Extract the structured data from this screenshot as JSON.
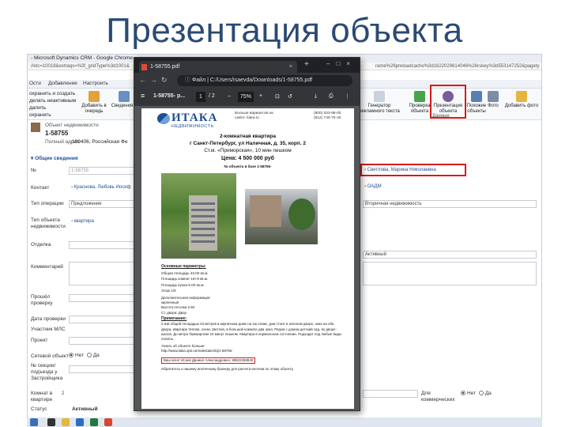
{
  "slide": {
    "title": "Презентация объекта"
  },
  "crm": {
    "window_title": "- Microsoft Dynamics CRM - Google Chrome",
    "url_left": "//etc=10018&extraqs=%3f_gridType%3d1001&",
    "url_right": "rame%26preloadcache%3d1622029614046%26rskey%3d553147252&pagety",
    "tabs": [
      "Ости",
      "Добавление",
      "Настроить"
    ],
    "left_actions": [
      "охранить и создать",
      "делать неактивным",
      "далить",
      "охранить"
    ],
    "ribbon_buttons": [
      "Добавить в очередь",
      "Сведения о",
      "Генератор рекламного текста",
      "Проверка объекта",
      "Презентация объекта",
      "Похожие объекты",
      "Фото",
      "Добавить фото"
    ],
    "ribbon_sub": "Данные",
    "entity_type": "Объект недвижимости",
    "record_id": "1-58755",
    "address_label": "Полный адрес",
    "address_value": "199406, Российская Фе",
    "section_general": "Общие сведения",
    "fields": {
      "number": {
        "label": "№",
        "value": "1-58755"
      },
      "contact": {
        "label": "Контакт",
        "value": "Краснова, Любовь Иосиф"
      },
      "op_type": {
        "label": "Тип операции",
        "value": "Предложение"
      },
      "obj_type": {
        "label": "Тип объекта недвижимости",
        "value": "квартира"
      },
      "dept": {
        "label": "Отделка",
        "value": ""
      },
      "comment": {
        "label": "Комментарий",
        "value": ""
      },
      "last_check": {
        "label": "Прошёл проверку",
        "value": ""
      },
      "next_check": {
        "label": "Дата проверки",
        "value": ""
      },
      "mls": {
        "label": "Участник МЛС",
        "value": ""
      },
      "project": {
        "label": "Проект",
        "value": ""
      },
      "network": {
        "label": "Сетевой объект",
        "yes": "Нет",
        "no": "Да"
      },
      "section": {
        "label": "№ секции/подъезда у Застройщика",
        "value": ""
      },
      "rooms": {
        "label": "Комнат в квартире",
        "value": "2"
      },
      "status": {
        "label": "Статус",
        "value": "Активный"
      },
      "owner": {
        "value": "Светлова, Марина Николаевна"
      },
      "office": {
        "value": "ОАДМ"
      },
      "market": {
        "value": "Вторичная недвижимость"
      },
      "state": {
        "value": "Активный"
      },
      "commercial": {
        "label": "Для коммерческих",
        "yes": "Нет",
        "no": "Да"
      }
    }
  },
  "pdf": {
    "tab_title": "1-58755.pdf",
    "address": "C:/Users/isaevda/Downloads/1-58755.pdf",
    "address_prefix": "Файл",
    "doc_name": "1-58755- p...",
    "page_current": "1",
    "page_total": "/ 2",
    "zoom": "75%",
    "logo_main": "ИТАКА",
    "logo_sub": "НЕДВИЖИМОСТЬ",
    "info_text": "Больше вариантов на сайте: itaka.ru",
    "phones": [
      "(800) 333-96-00",
      "(812) 740-70-40"
    ],
    "heading": [
      "2-комнатная квартира",
      "г Санкт-Петербург, ул Наличная, д. 35, корп. 2",
      "Ст.м. «Приморская», 10 мин пешком",
      "Цена: 4 500 000 руб"
    ],
    "base_num": "№ объекта в базе 1-58755-",
    "params_title": "Основные параметры:",
    "params": [
      "Общая площадь 43.00 кв.м.",
      "Площадь комнат 16+9 кв.м.",
      "Площадь кухни 6.00 кв.м.",
      "Этаж 1/5"
    ],
    "extra_title": "Дополнительная информация:",
    "extra": [
      "кирпичный",
      "Высота потолка 2.50",
      "Ст. двора: Двор"
    ],
    "note_title": "Примечание:",
    "note": "2 изв общей площадью 43 метров в кирпичном доме на 1м этаже, дом стоит в зеленом дворе, окна на оба двора, квартира тёплая, очень светлая, в большой комнате два окна. Рядом с домом детский сад, во дворе - школа. До метро Приморская 10 минут пешком. Квартира в нормальном состоянии. Подходит под любые виды оплаты.",
    "more_label": "Узнать об объекте больше:",
    "more_link": "http://www.itaka.spb.ru/realestate/obj/1-58755-",
    "agent": "Ваш агент Исаев Даниил Александрович, 89522268940",
    "footer": "Обратитесь к нашему ипотечному брокеру для расчета ипотеки по этому объекту."
  }
}
